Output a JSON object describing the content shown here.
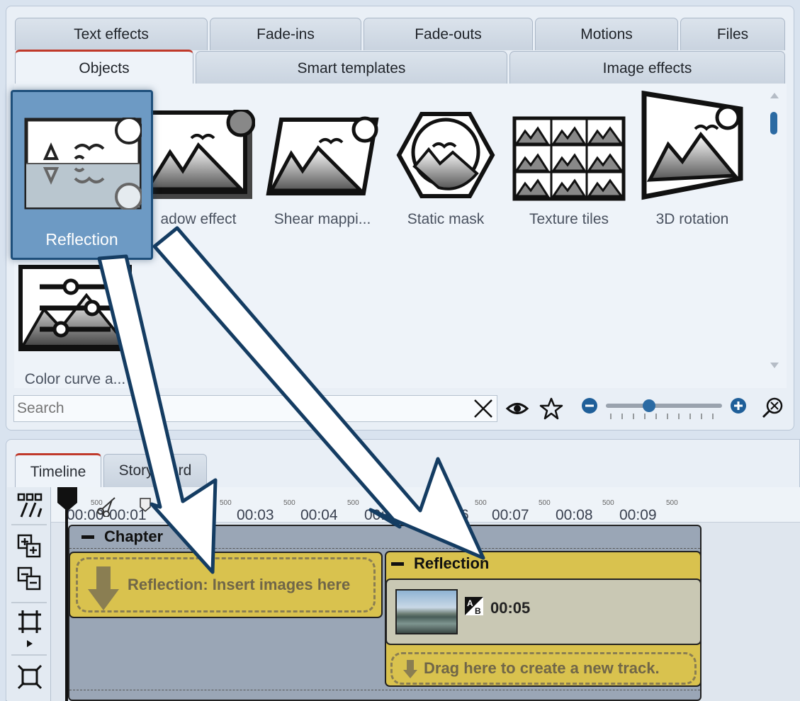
{
  "effect_tabs_row1": [
    {
      "label": "Text effects"
    },
    {
      "label": "Fade-ins"
    },
    {
      "label": "Fade-outs"
    },
    {
      "label": "Motions"
    },
    {
      "label": "Files"
    }
  ],
  "effect_tabs_row2": [
    {
      "label": "Objects",
      "active": true
    },
    {
      "label": "Smart templates"
    },
    {
      "label": "Image effects"
    }
  ],
  "effects": [
    {
      "label": "Reflection",
      "icon": "reflection-icon",
      "selected": true
    },
    {
      "label": "adow effect",
      "icon": "shadow-effect-icon"
    },
    {
      "label": "Shear mappi...",
      "icon": "shear-mapping-icon"
    },
    {
      "label": "Static mask",
      "icon": "static-mask-icon"
    },
    {
      "label": "Texture tiles",
      "icon": "texture-tiles-icon"
    },
    {
      "label": "3D rotation",
      "icon": "3d-rotation-icon"
    },
    {
      "label": "Color curve a...",
      "icon": "color-curve-icon"
    }
  ],
  "search": {
    "placeholder": "Search",
    "value": ""
  },
  "timeline_tabs": [
    {
      "label": "Timeline",
      "active": true
    },
    {
      "label": "Storyboard"
    }
  ],
  "ruler": {
    "labels": [
      "00:00",
      "00:01",
      "00:03",
      "00:04",
      "00:0",
      "6",
      "00:07",
      "00:08",
      "00:09"
    ],
    "small_label": "500"
  },
  "chapter": {
    "title": "Chapter"
  },
  "drop_placeholder": "Reflection: Insert images here",
  "reflection_group": {
    "title": "Reflection",
    "clip_duration": "00:05",
    "new_track": "Drag here to create a new track."
  },
  "colors": {
    "accent_blue": "#2b6aa3",
    "selected_card": "#6d9ac4",
    "track_yellow": "#d9c24e",
    "active_tab_marker": "#c0392b"
  }
}
